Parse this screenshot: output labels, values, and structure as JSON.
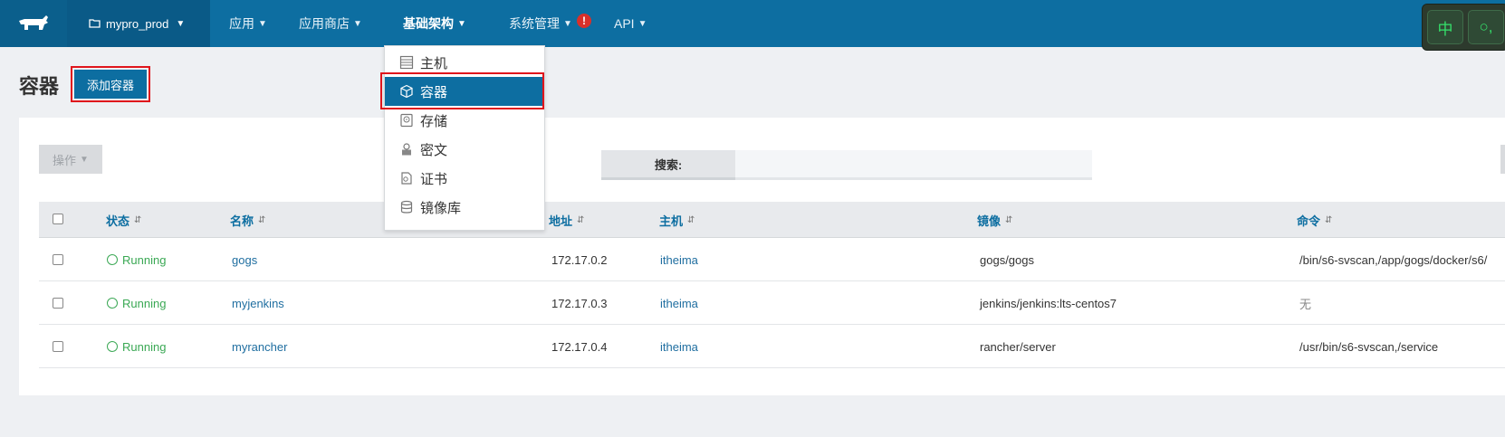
{
  "nav": {
    "environment": "mypro_prod",
    "items": [
      {
        "label": "应用",
        "active": false
      },
      {
        "label": "应用商店",
        "active": false
      },
      {
        "label": "基础架构",
        "active": true
      },
      {
        "label": "系统管理",
        "active": false
      },
      {
        "label": "API",
        "active": false
      }
    ],
    "alert_badge": "!",
    "ime": [
      "中",
      "○,"
    ]
  },
  "page": {
    "title": "容器",
    "add_button": "添加容器"
  },
  "toolbar": {
    "actions_label": "操作",
    "search_label": "搜索:",
    "search_value": ""
  },
  "dropdown": {
    "items": [
      {
        "label": "主机",
        "icon": "host-icon"
      },
      {
        "label": "容器",
        "icon": "cube-icon",
        "active": true
      },
      {
        "label": "存储",
        "icon": "storage-icon"
      },
      {
        "label": "密文",
        "icon": "secret-icon"
      },
      {
        "label": "证书",
        "icon": "certificate-icon"
      },
      {
        "label": "镜像库",
        "icon": "registry-icon"
      }
    ]
  },
  "table": {
    "columns": {
      "status": "状态",
      "name": "名称",
      "address": "地址",
      "host": "主机",
      "image": "镜像",
      "command": "命令"
    },
    "rows": [
      {
        "status": "Running",
        "name": "gogs",
        "address": "172.17.0.2",
        "host": "itheima",
        "image": "gogs/gogs",
        "command": "/bin/s6-svscan,/app/gogs/docker/s6/"
      },
      {
        "status": "Running",
        "name": "myjenkins",
        "address": "172.17.0.3",
        "host": "itheima",
        "image": "jenkins/jenkins:lts-centos7",
        "command": "无"
      },
      {
        "status": "Running",
        "name": "myrancher",
        "address": "172.17.0.4",
        "host": "itheima",
        "image": "rancher/server",
        "command": "/usr/bin/s6-svscan,/service"
      }
    ]
  },
  "colors": {
    "primary": "#0d6ea1",
    "running": "#3aa854",
    "highlight_border": "#e0151c"
  }
}
